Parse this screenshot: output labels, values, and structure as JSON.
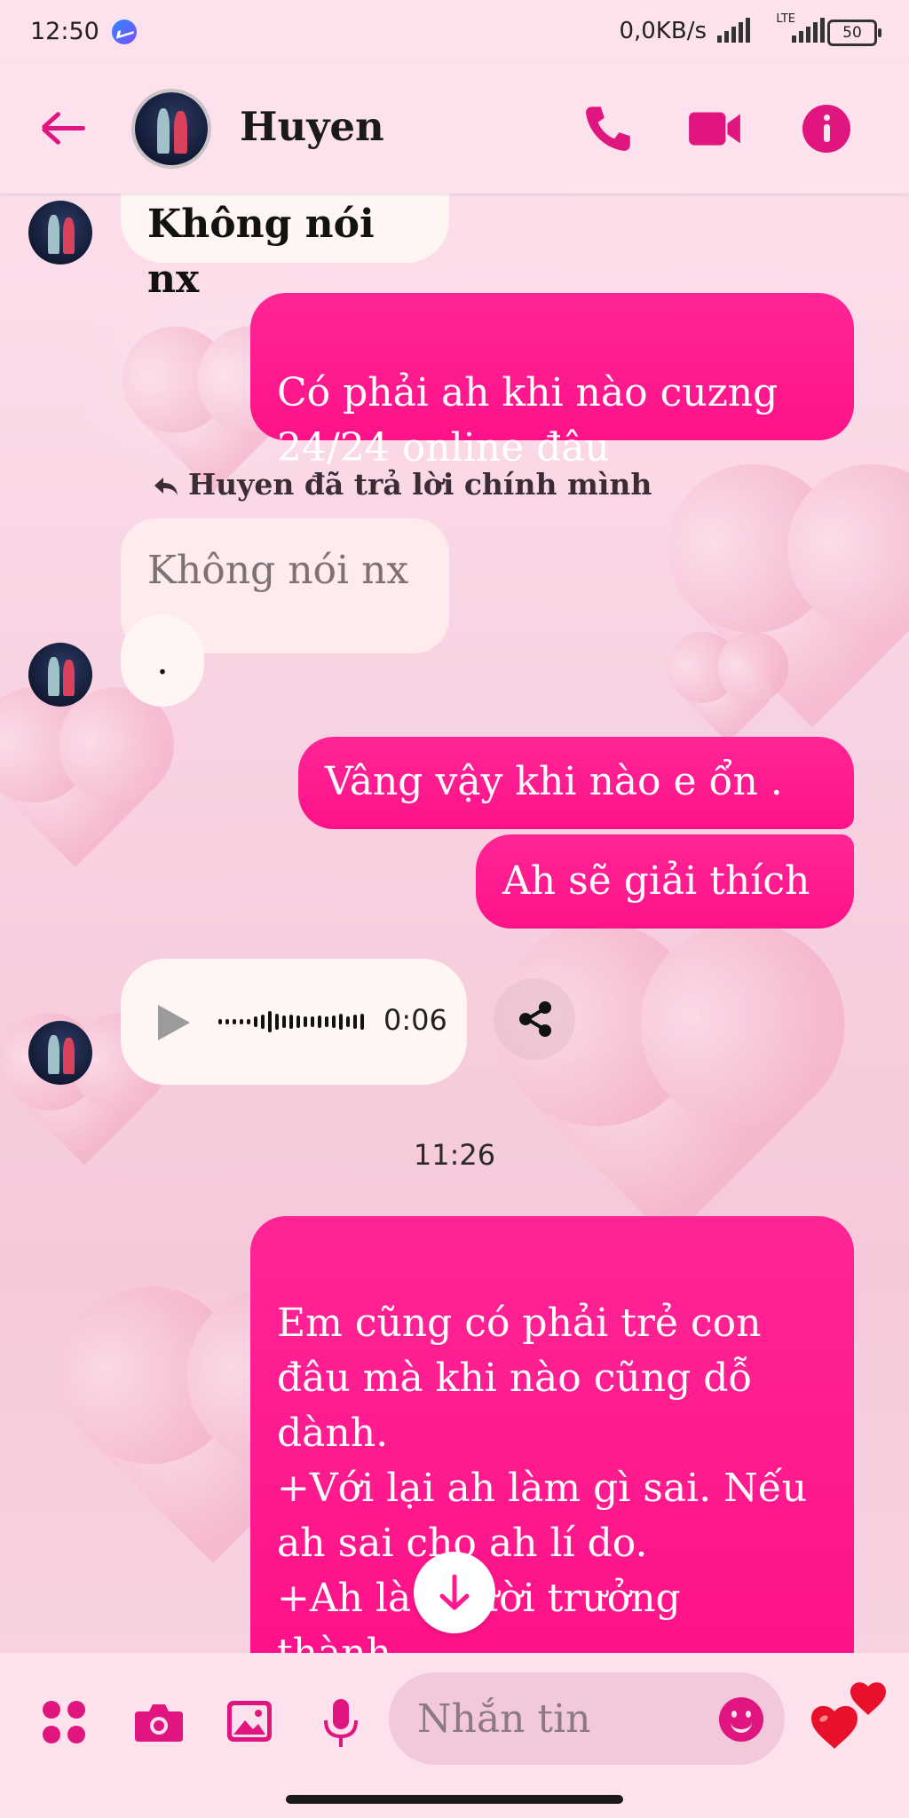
{
  "status_bar": {
    "time": "12:50",
    "net_speed": "0,0KB/s",
    "network_type": "LTE",
    "battery": "50"
  },
  "header": {
    "contact_name": "Huyen"
  },
  "messages": {
    "m1": "Không nói nx",
    "m2": "Có phải ah khi nào  cuzng\n24/24 online đâu",
    "reply_label": "Huyen đã trả lời chính mình",
    "m3_quoted": "Không nói nx",
    "m3": ".",
    "m4": "Vâng  vậy khi nào e ổn .",
    "m5": "Ah sẽ giải thích",
    "voice_duration": "0:06",
    "timestamp": "11:26",
    "m6": "Em cũng có phải trẻ con\nđâu mà khi nào cũng dỗ\ndành.\n+Với lại ah làm gì sai. Nếu\nah sai  cho ah lí do.\n +Ah là người trưởng\nthành\nE cũng phải nghĩ cho ah"
  },
  "composer": {
    "placeholder": "Nhắn tin"
  },
  "colors": {
    "accent": "#e0157f",
    "outgoing_bubble": "#ff1a8f",
    "incoming_bubble": "#fff5f3",
    "header_bg": "#fde1ec"
  },
  "icons": [
    "back-arrow-icon",
    "phone-icon",
    "video-call-icon",
    "info-icon",
    "play-icon",
    "share-icon",
    "arrow-down-icon",
    "apps-icon",
    "camera-icon",
    "gallery-icon",
    "microphone-icon",
    "emoji-icon",
    "hearts-icon"
  ]
}
